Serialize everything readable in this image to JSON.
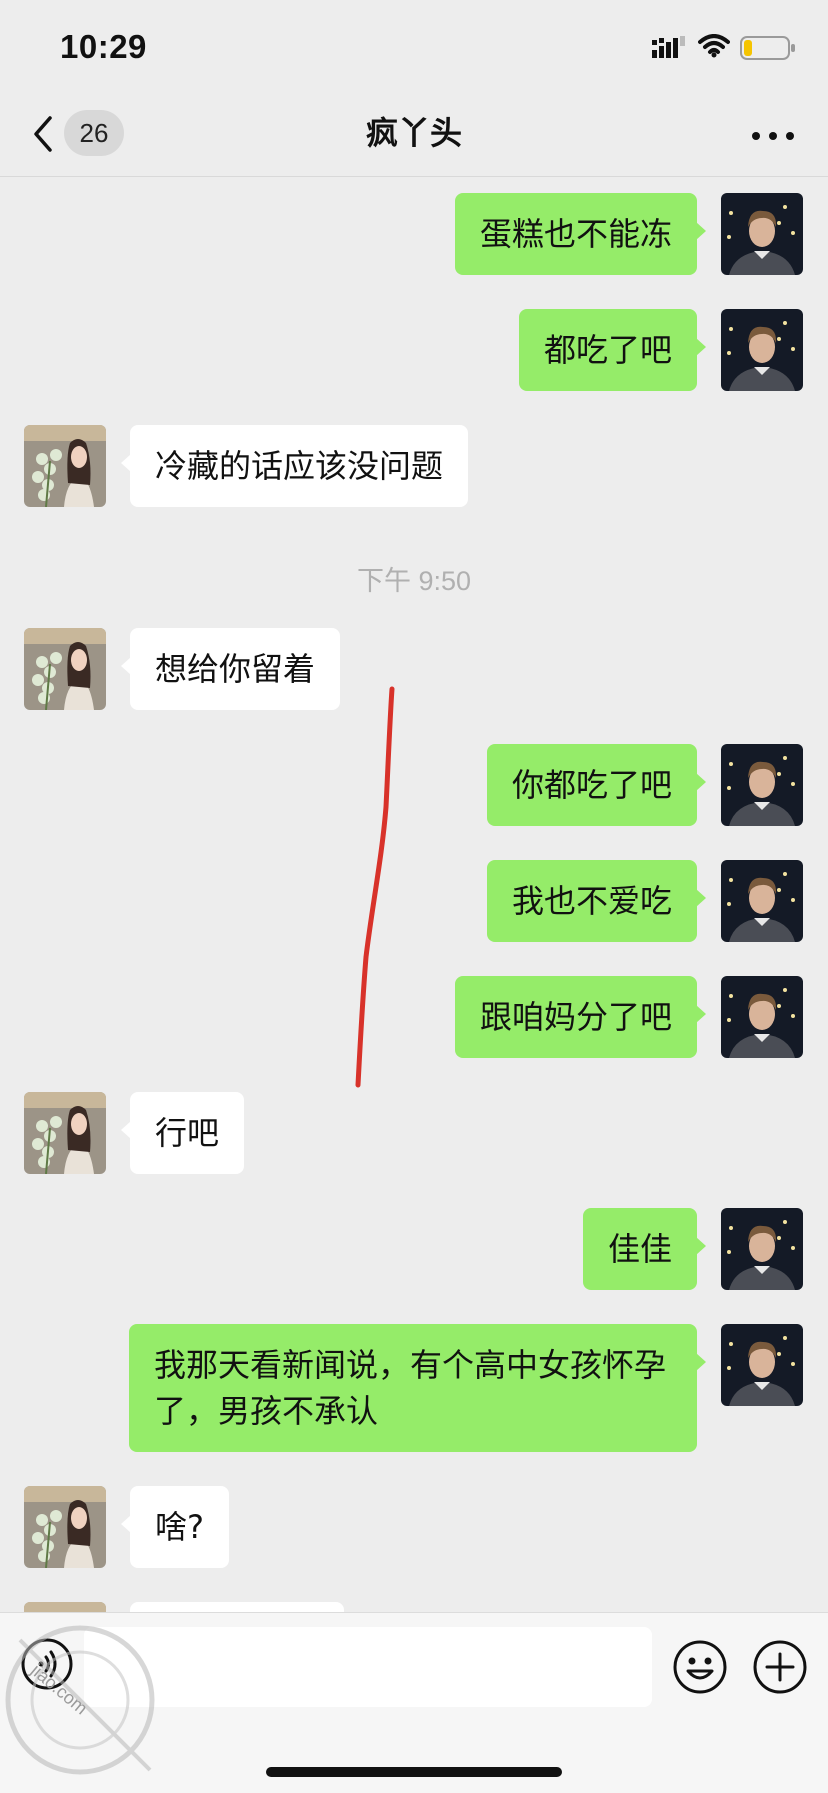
{
  "status_bar": {
    "time": "10:29",
    "signal_icon": "cellular-signal-icon",
    "wifi_icon": "wifi-icon",
    "battery_icon": "battery-low-icon"
  },
  "nav": {
    "back_icon": "chevron-left-icon",
    "unread_count": "26",
    "title": "疯丫头",
    "more_icon": "more-dots-icon"
  },
  "colors": {
    "outgoing_bubble": "#95ec69",
    "incoming_bubble": "#ffffff",
    "background": "#ededed",
    "annotation": "#d8322a"
  },
  "messages": [
    {
      "dir": "out",
      "text": "蛋糕也不能冻"
    },
    {
      "dir": "out",
      "text": "都吃了吧"
    },
    {
      "dir": "in",
      "text": "冷藏的话应该没问题"
    },
    {
      "type": "time",
      "text": "下午 9:50"
    },
    {
      "dir": "in",
      "text": "想给你留着"
    },
    {
      "dir": "out",
      "text": "你都吃了吧"
    },
    {
      "dir": "out",
      "text": "我也不爱吃"
    },
    {
      "dir": "out",
      "text": "跟咱妈分了吧"
    },
    {
      "dir": "in",
      "text": "行吧"
    },
    {
      "dir": "out",
      "text": "佳佳"
    },
    {
      "dir": "out",
      "text": "我那天看新闻说，有个高中女孩怀孕了，男孩不承认"
    },
    {
      "dir": "in",
      "text": "啥?"
    },
    {
      "dir": "in",
      "text": ""
    }
  ],
  "input_bar": {
    "voice_icon": "voice-icon",
    "emoji_icon": "emoji-icon",
    "plus_icon": "plus-icon",
    "input_value": ""
  },
  "watermark": {
    "text": "jiao.com"
  }
}
